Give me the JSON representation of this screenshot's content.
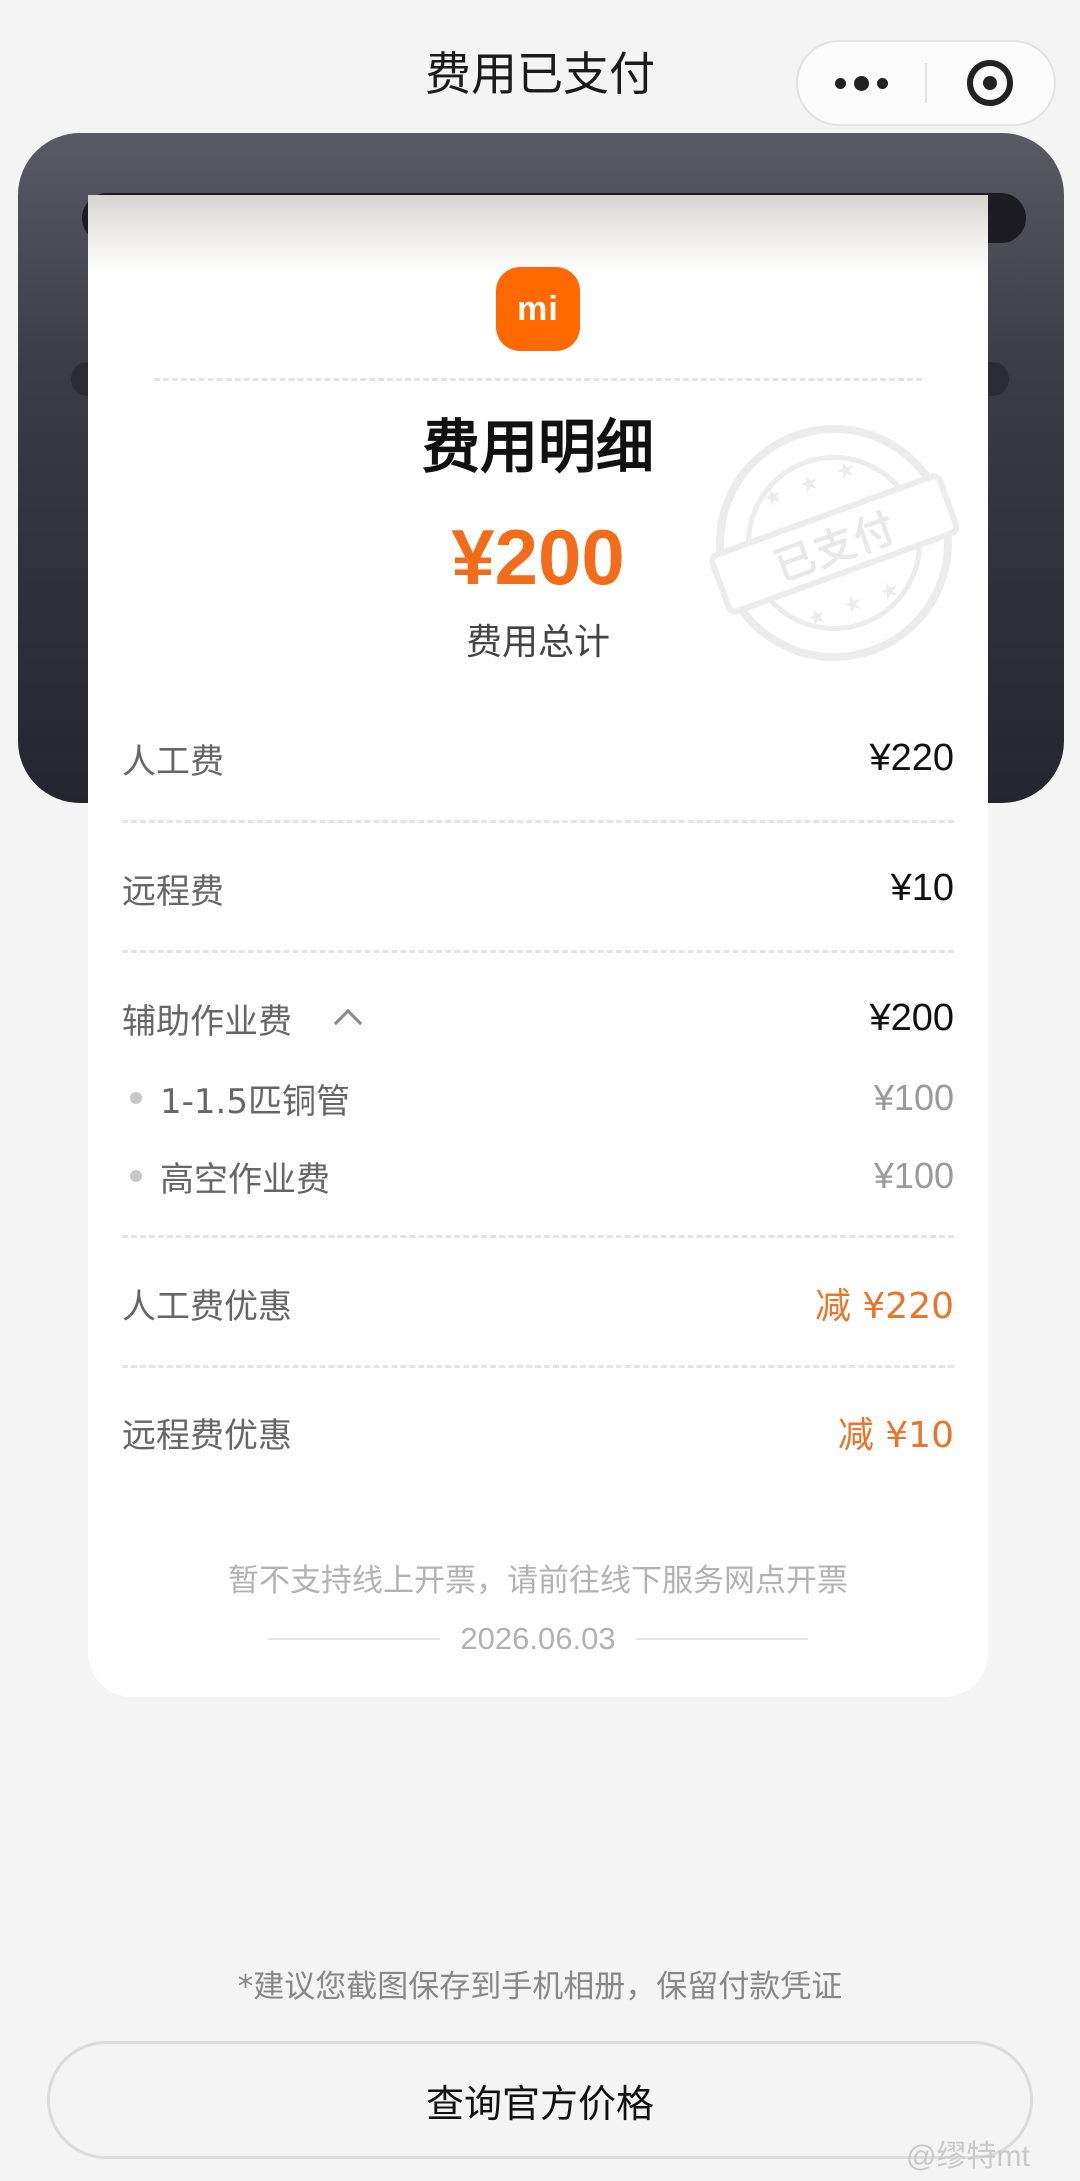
{
  "header": {
    "title": "费用已支付"
  },
  "receipt": {
    "logo_text": "mi",
    "title": "费用明细",
    "total": "¥200",
    "total_label": "费用总计",
    "stamp_text": "已支付",
    "rows": [
      {
        "label": "人工费",
        "amount": "¥220"
      },
      {
        "label": "远程费",
        "amount": "¥10"
      },
      {
        "label": "辅助作业费",
        "amount": "¥200",
        "items": [
          {
            "label": "1-1.5匹铜管",
            "amount": "¥100"
          },
          {
            "label": "高空作业费",
            "amount": "¥100"
          }
        ]
      },
      {
        "label": "人工费优惠",
        "amount": "减 ¥220"
      },
      {
        "label": "远程费优惠",
        "amount": "减 ¥10"
      }
    ],
    "notice": "暂不支持线上开票，请前往线下服务网点开票",
    "date": "2026.06.03"
  },
  "footer": {
    "hint": "*建议您截图保存到手机相册，保留付款凭证",
    "button_label": "查询官方价格"
  },
  "watermark": "@缪特mt",
  "colors": {
    "accent": "#f26c1a",
    "discount": "#e8762a",
    "logo": "#ff6900"
  }
}
